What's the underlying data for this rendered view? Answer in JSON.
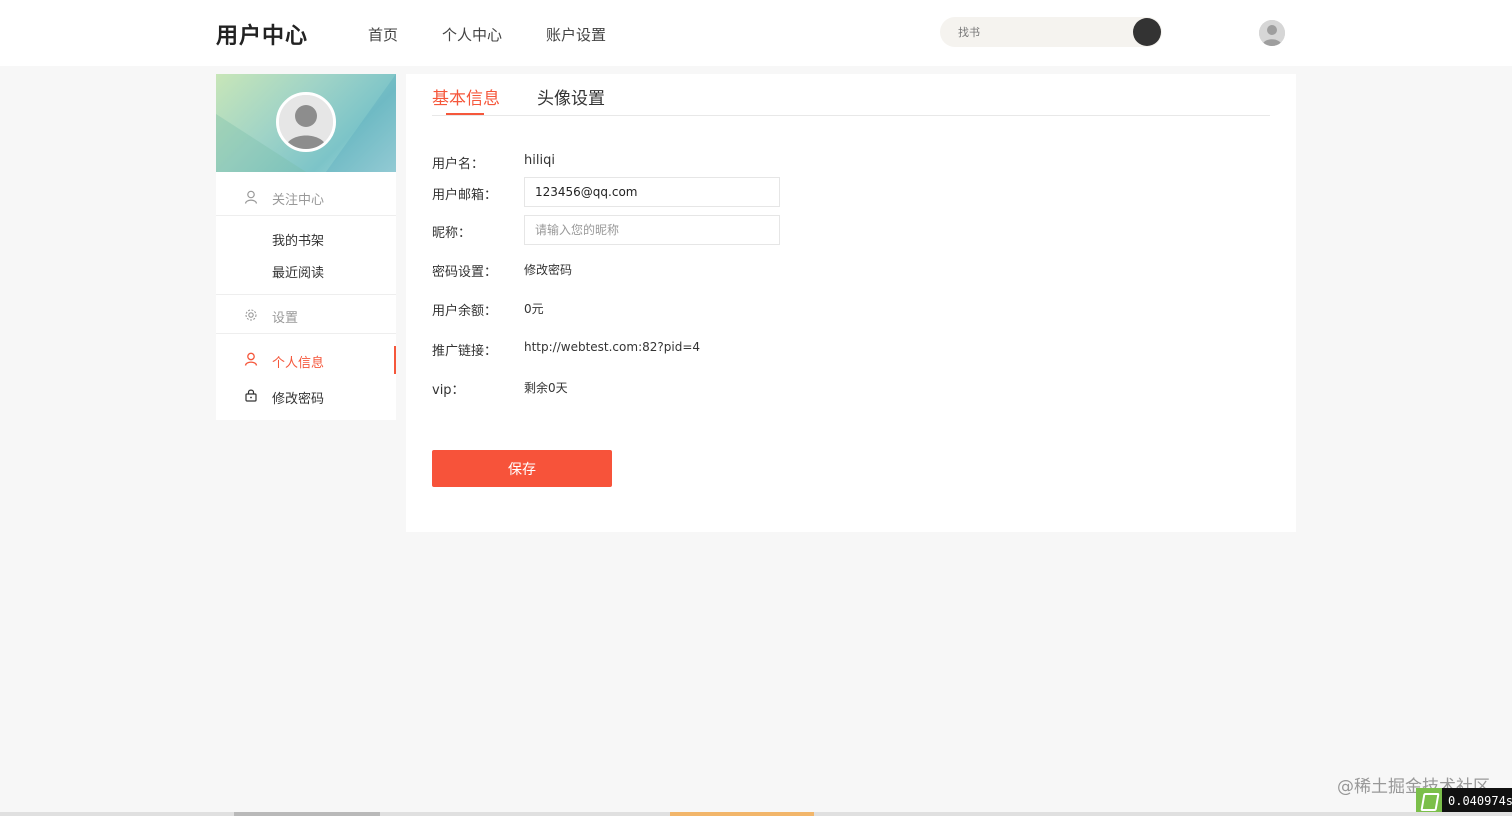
{
  "header": {
    "brand": "用户中心",
    "nav": [
      "首页",
      "个人中心",
      "账户设置"
    ],
    "search_placeholder": "找书"
  },
  "sidebar": {
    "section_follow": "关注中心",
    "follow_items": [
      "我的书架",
      "最近阅读"
    ],
    "section_settings": "设置",
    "settings_items": [
      {
        "label": "个人信息",
        "active": true
      },
      {
        "label": "修改密码",
        "active": false
      }
    ]
  },
  "tabs": [
    {
      "label": "基本信息",
      "active": true
    },
    {
      "label": "头像设置",
      "active": false
    }
  ],
  "form": {
    "username_label": "用户名：",
    "username_value": "hiliqi",
    "email_label": "用户邮箱：",
    "email_value": "123456@qq.com",
    "nickname_label": "昵称：",
    "nickname_placeholder": "请输入您的昵称",
    "password_label": "密码设置：",
    "password_link": "修改密码",
    "balance_label": "用户余额：",
    "balance_value": "0元",
    "promo_label": "推广链接：",
    "promo_value": "http://webtest.com:82?pid=4",
    "vip_label": "vip：",
    "vip_value": "剩余0天",
    "save_label": "保存"
  },
  "overlay": {
    "watermark": "@稀土掘金技术社区",
    "timer": "0.040974s"
  },
  "colors": {
    "accent": "#f5573b",
    "save_button": "#f7533a"
  }
}
